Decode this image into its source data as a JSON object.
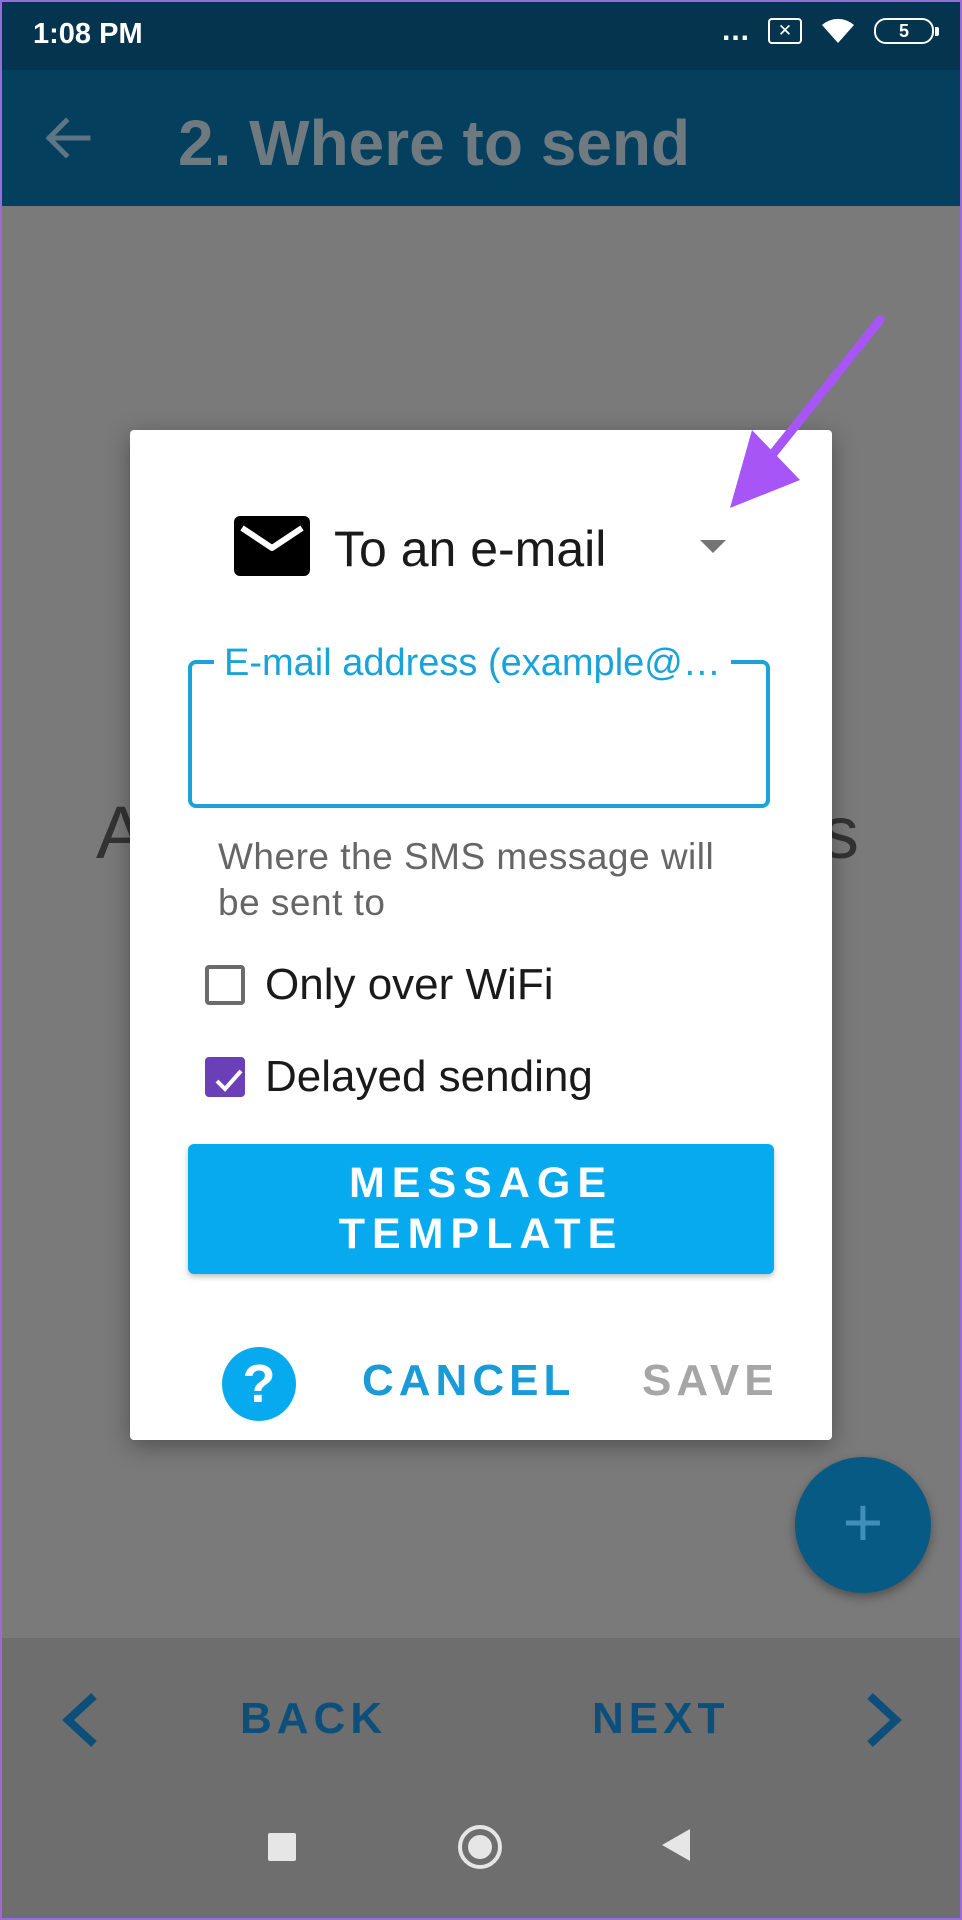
{
  "status_bar": {
    "time": "1:08 PM",
    "dots": "...",
    "sim_label": "✕",
    "battery_level": "5"
  },
  "app_bar": {
    "title": "2. Where to send"
  },
  "background": {
    "left_fragment": "A",
    "right_fragment": "s"
  },
  "fab": {
    "label": "+"
  },
  "bottom_nav": {
    "back_label": "BACK",
    "next_label": "NEXT"
  },
  "dialog": {
    "destination_label": "To an e-mail",
    "email_field": {
      "label": "E-mail address (example@…",
      "value": ""
    },
    "helper_text": "Where the SMS message will be sent to",
    "checkbox_wifi": {
      "label": "Only over WiFi",
      "checked": false
    },
    "checkbox_delay": {
      "label": "Delayed sending",
      "checked": true
    },
    "template_button": {
      "line1": "MESSAGE",
      "line2": "TEMPLATE"
    },
    "help_label": "?",
    "cancel_label": "CANCEL",
    "save_label": "SAVE"
  },
  "colors": {
    "accent": "#07aaee",
    "checkbox_checked": "#6a3fb7",
    "annotation_arrow": "#a855f7"
  }
}
